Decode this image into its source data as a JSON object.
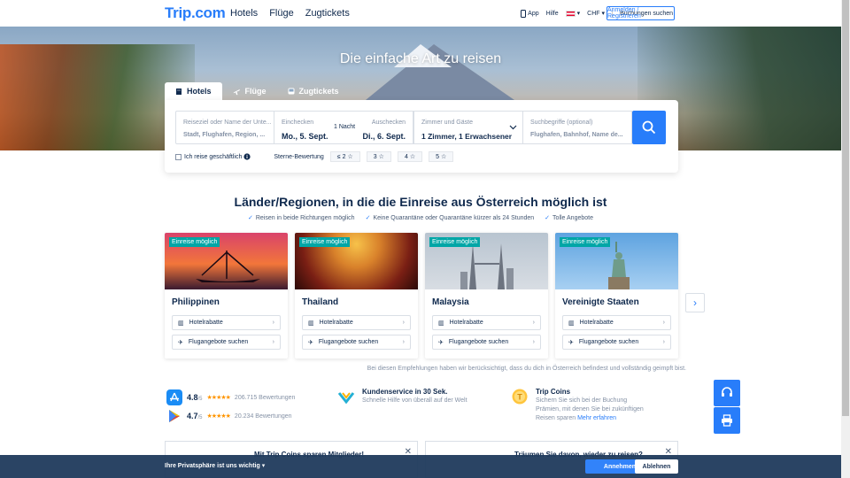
{
  "header": {
    "logo": "Trip.com",
    "nav": [
      "Hotels",
      "Flüge",
      "Zugtickets"
    ],
    "app": "App",
    "help": "Hilfe",
    "currency": "CHF",
    "bookings": "Buchungen suchen",
    "login": "Anmelden / Registrieren"
  },
  "hero": {
    "title": "Die einfache Art zu reisen"
  },
  "tabs": [
    {
      "label": "Hotels",
      "active": true
    },
    {
      "label": "Flüge",
      "active": false
    },
    {
      "label": "Zugtickets",
      "active": false
    }
  ],
  "search": {
    "destination_label": "Reiseziel oder Name der Unte...",
    "destination_placeholder": "Stadt, Flughafen, Region, ...",
    "checkin_label": "Einchecken",
    "checkin_value": "Mo., 5. Sept.",
    "nights": "1 Nacht",
    "checkout_label": "Auschecken",
    "checkout_value": "Di., 6. Sept.",
    "guests_label": "Zimmer und Gäste",
    "guests_value": "1 Zimmer, 1 Erwachsener",
    "keywords_label": "Suchbegriffe (optional)",
    "keywords_placeholder": "Flughafen, Bahnhof, Name de..."
  },
  "filters": {
    "business": "Ich reise geschäftlich",
    "stars_label": "Sterne-Bewertung",
    "star_options": [
      "≤ 2",
      "3",
      "4",
      "5"
    ]
  },
  "section": {
    "title": "Länder/Regionen, in die die Einreise aus Österreich möglich ist",
    "checks": [
      "Reisen in beide Richtungen möglich",
      "Keine Quarantäne oder Quarantäne kürzer als 24 Stunden",
      "Tolle Angebote"
    ]
  },
  "cards": [
    {
      "badge": "Einreise möglich",
      "name": "Philippinen",
      "hotel": "Hotelrabatte",
      "flight": "Flugangebote suchen"
    },
    {
      "badge": "Einreise möglich",
      "name": "Thailand",
      "hotel": "Hotelrabatte",
      "flight": "Flugangebote suchen"
    },
    {
      "badge": "Einreise möglich",
      "name": "Malaysia",
      "hotel": "Hotelrabatte",
      "flight": "Flugangebote suchen"
    },
    {
      "badge": "Einreise möglich",
      "name": "Vereinigte Staaten",
      "hotel": "Hotelrabatte",
      "flight": "Flugangebote suchen"
    }
  ],
  "disclaimer": "Bei diesen Empfehlungen haben wir berücksichtigt, dass du dich in Österreich befindest und vollständig geimpft bist.",
  "ratings": [
    {
      "score": "4.8",
      "max": "/5",
      "stars": "★★★★★",
      "count": "206.715 Bewertungen"
    },
    {
      "score": "4.7",
      "max": "/5",
      "stars": "★★★★★",
      "count": "20.234 Bewertungen"
    }
  ],
  "features": {
    "service_title": "Kundenservice in 30 Sek.",
    "service_text": "Schnelle Hilfe von überall auf der Welt",
    "coins_title": "Trip Coins",
    "coins_text1": "Sichern Sie sich bei der Buchung",
    "coins_text2": "Prämien, mit denen Sie bei zukünftigen",
    "coins_text3": "Reisen sparen",
    "coins_link": "Mehr erfahren"
  },
  "promos": {
    "left_title": "Mit Trip Coins sparen Mitglieder!",
    "right_title": "Träumen Sie davon, wieder zu reisen?"
  },
  "cookie": {
    "text": "Ihre Privatsphäre ist uns wichtig",
    "accept": "Annehmen",
    "decline": "Ablehnen"
  }
}
